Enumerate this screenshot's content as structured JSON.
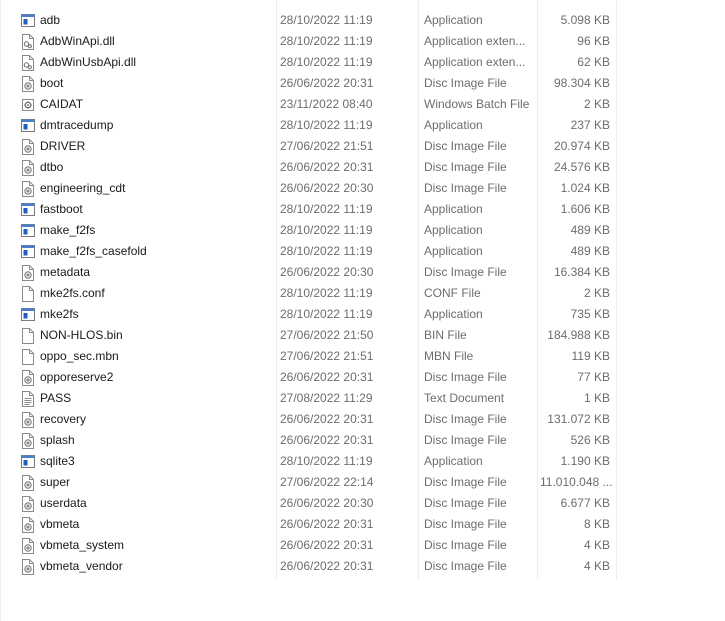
{
  "files": [
    {
      "name": "adb",
      "modified": "28/10/2022 11:19",
      "type": "Application",
      "size": "5.098 KB",
      "icon": "application-icon"
    },
    {
      "name": "AdbWinApi.dll",
      "modified": "28/10/2022 11:19",
      "type": "Application exten...",
      "size": "96 KB",
      "icon": "dll-file-icon"
    },
    {
      "name": "AdbWinUsbApi.dll",
      "modified": "28/10/2022 11:19",
      "type": "Application exten...",
      "size": "62 KB",
      "icon": "dll-file-icon"
    },
    {
      "name": "boot",
      "modified": "26/06/2022 20:31",
      "type": "Disc Image File",
      "size": "98.304 KB",
      "icon": "disc-image-icon"
    },
    {
      "name": "CAIDAT",
      "modified": "23/11/2022 08:40",
      "type": "Windows Batch File",
      "size": "2 KB",
      "icon": "batch-file-icon"
    },
    {
      "name": "dmtracedump",
      "modified": "28/10/2022 11:19",
      "type": "Application",
      "size": "237 KB",
      "icon": "application-icon"
    },
    {
      "name": "DRIVER",
      "modified": "27/06/2022 21:51",
      "type": "Disc Image File",
      "size": "20.974 KB",
      "icon": "disc-image-icon"
    },
    {
      "name": "dtbo",
      "modified": "26/06/2022 20:31",
      "type": "Disc Image File",
      "size": "24.576 KB",
      "icon": "disc-image-icon"
    },
    {
      "name": "engineering_cdt",
      "modified": "26/06/2022 20:30",
      "type": "Disc Image File",
      "size": "1.024 KB",
      "icon": "disc-image-icon"
    },
    {
      "name": "fastboot",
      "modified": "28/10/2022 11:19",
      "type": "Application",
      "size": "1.606 KB",
      "icon": "application-icon"
    },
    {
      "name": "make_f2fs",
      "modified": "28/10/2022 11:19",
      "type": "Application",
      "size": "489 KB",
      "icon": "application-icon"
    },
    {
      "name": "make_f2fs_casefold",
      "modified": "28/10/2022 11:19",
      "type": "Application",
      "size": "489 KB",
      "icon": "application-icon"
    },
    {
      "name": "metadata",
      "modified": "26/06/2022 20:30",
      "type": "Disc Image File",
      "size": "16.384 KB",
      "icon": "disc-image-icon"
    },
    {
      "name": "mke2fs.conf",
      "modified": "28/10/2022 11:19",
      "type": "CONF File",
      "size": "2 KB",
      "icon": "blank-file-icon"
    },
    {
      "name": "mke2fs",
      "modified": "28/10/2022 11:19",
      "type": "Application",
      "size": "735 KB",
      "icon": "application-icon"
    },
    {
      "name": "NON-HLOS.bin",
      "modified": "27/06/2022 21:50",
      "type": "BIN File",
      "size": "184.988 KB",
      "icon": "blank-file-icon"
    },
    {
      "name": "oppo_sec.mbn",
      "modified": "27/06/2022 21:51",
      "type": "MBN File",
      "size": "119 KB",
      "icon": "blank-file-icon"
    },
    {
      "name": "opporeserve2",
      "modified": "26/06/2022 20:31",
      "type": "Disc Image File",
      "size": "77 KB",
      "icon": "disc-image-icon"
    },
    {
      "name": "PASS",
      "modified": "27/08/2022 11:29",
      "type": "Text Document",
      "size": "1 KB",
      "icon": "text-document-icon"
    },
    {
      "name": "recovery",
      "modified": "26/06/2022 20:31",
      "type": "Disc Image File",
      "size": "131.072 KB",
      "icon": "disc-image-icon"
    },
    {
      "name": "splash",
      "modified": "26/06/2022 20:31",
      "type": "Disc Image File",
      "size": "526 KB",
      "icon": "disc-image-icon"
    },
    {
      "name": "sqlite3",
      "modified": "28/10/2022 11:19",
      "type": "Application",
      "size": "1.190 KB",
      "icon": "application-icon"
    },
    {
      "name": "super",
      "modified": "27/06/2022 22:14",
      "type": "Disc Image File",
      "size": "11.010.048 ...",
      "icon": "disc-image-icon"
    },
    {
      "name": "userdata",
      "modified": "26/06/2022 20:30",
      "type": "Disc Image File",
      "size": "6.677 KB",
      "icon": "disc-image-icon"
    },
    {
      "name": "vbmeta",
      "modified": "26/06/2022 20:31",
      "type": "Disc Image File",
      "size": "8 KB",
      "icon": "disc-image-icon"
    },
    {
      "name": "vbmeta_system",
      "modified": "26/06/2022 20:31",
      "type": "Disc Image File",
      "size": "4 KB",
      "icon": "disc-image-icon"
    },
    {
      "name": "vbmeta_vendor",
      "modified": "26/06/2022 20:31",
      "type": "Disc Image File",
      "size": "4 KB",
      "icon": "disc-image-icon"
    }
  ],
  "colors": {
    "app_icon_blue": "#1f5fbf",
    "text_primary": "#1a1a1a",
    "text_secondary": "#6d6d6d",
    "column_divider": "#ededed"
  }
}
